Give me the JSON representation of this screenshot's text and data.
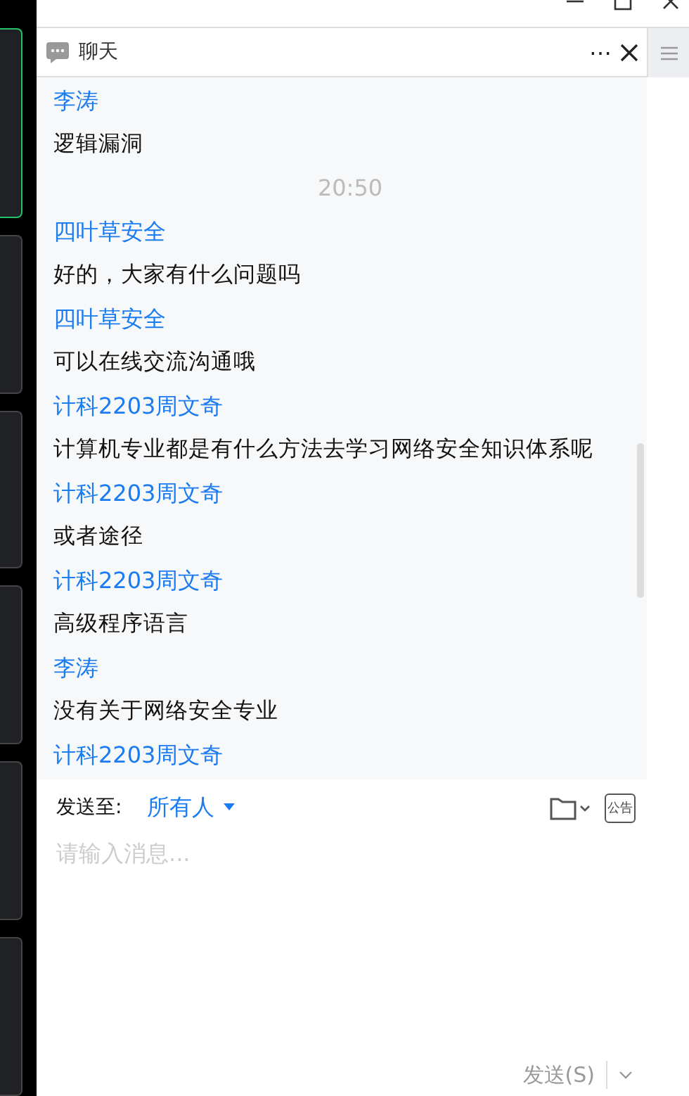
{
  "video_tiles": [
    {
      "selected": true
    },
    {
      "selected": false
    },
    {
      "selected": false
    },
    {
      "selected": false
    },
    {
      "selected": false
    },
    {
      "selected": false
    }
  ],
  "chat": {
    "title": "聊天",
    "more": "⋯",
    "messages": [
      {
        "kind": "name",
        "text": "李涛"
      },
      {
        "kind": "text",
        "text": "逻辑漏洞"
      },
      {
        "kind": "time",
        "text": "20:50"
      },
      {
        "kind": "name",
        "text": "四叶草安全"
      },
      {
        "kind": "text",
        "text": "好的，大家有什么问题吗"
      },
      {
        "kind": "name",
        "text": "四叶草安全"
      },
      {
        "kind": "text",
        "text": "可以在线交流沟通哦"
      },
      {
        "kind": "name",
        "text": "计科2203周文奇"
      },
      {
        "kind": "text",
        "text": "计算机专业都是有什么方法去学习网络安全知识体系呢"
      },
      {
        "kind": "name",
        "text": "计科2203周文奇"
      },
      {
        "kind": "text",
        "text": "或者途径"
      },
      {
        "kind": "name",
        "text": "计科2203周文奇"
      },
      {
        "kind": "text",
        "text": "高级程序语言"
      },
      {
        "kind": "name",
        "text": "李涛"
      },
      {
        "kind": "text",
        "text": "没有关于网络安全专业"
      },
      {
        "kind": "name",
        "text": "计科2203周文奇"
      }
    ],
    "send_to_label": "发送至:",
    "recipient": "所有人",
    "notice_icon_text": "公告",
    "input": {
      "placeholder": "请输入消息..."
    },
    "send_button": "发送(S)"
  }
}
